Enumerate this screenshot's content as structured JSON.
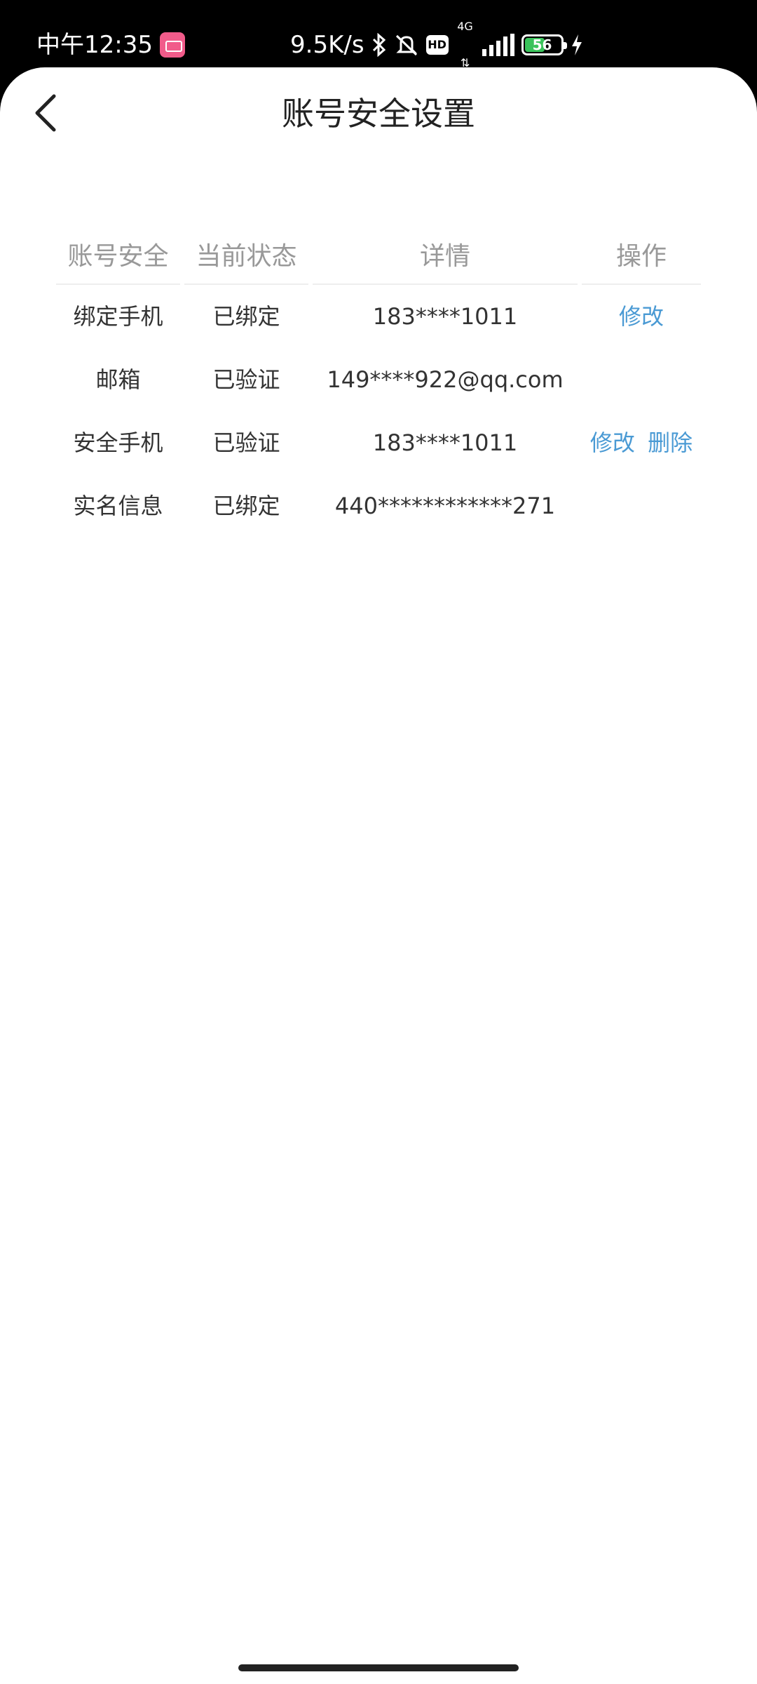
{
  "status_bar": {
    "time": "中午12:35",
    "speed": "9.5K/s",
    "network": "4G",
    "hd": "HD",
    "battery": "56",
    "battery_level": 0.56
  },
  "header": {
    "title": "账号安全设置"
  },
  "table": {
    "headers": [
      "账号安全",
      "当前状态",
      "详情",
      "操作"
    ],
    "rows": [
      {
        "item": "绑定手机",
        "status": "已绑定",
        "detail": "183****1011",
        "actions": [
          "修改"
        ]
      },
      {
        "item": "邮箱",
        "status": "已验证",
        "detail": "149****922@qq.com",
        "actions": []
      },
      {
        "item": "安全手机",
        "status": "已验证",
        "detail": "183****1011",
        "actions": [
          "修改",
          "删除"
        ]
      },
      {
        "item": "实名信息",
        "status": "已绑定",
        "detail": "440************271",
        "actions": []
      }
    ]
  },
  "colors": {
    "link": "#4a9ad4",
    "header_text": "#999999",
    "body_text": "#333333"
  }
}
